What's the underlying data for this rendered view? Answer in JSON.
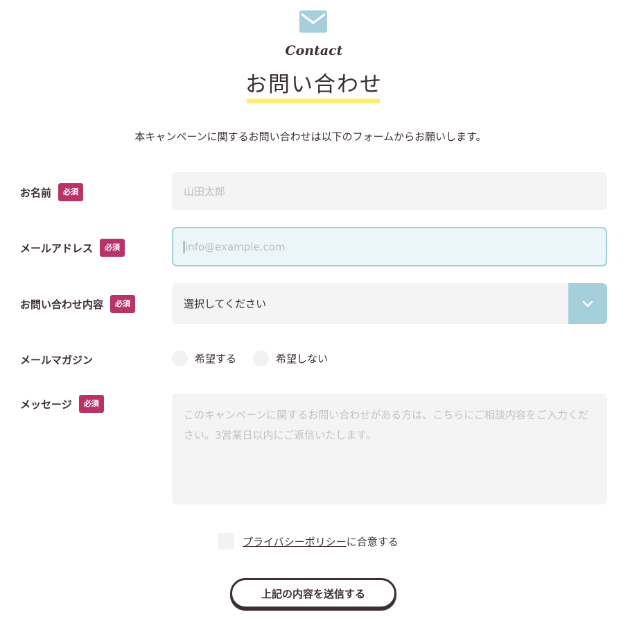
{
  "header": {
    "subtitle": "Contact",
    "title": "お問い合わせ",
    "intro": "本キャンペーンに関するお問い合わせは以下のフォームからお願いします。"
  },
  "colors": {
    "accent": "#a6cfdc",
    "required_badge": "#b93369",
    "underline": "#fcef73",
    "text": "#3e2f2f"
  },
  "form": {
    "required_label": "必須",
    "name": {
      "label": "お名前",
      "placeholder": "山田太郎",
      "value": ""
    },
    "email": {
      "label": "メールアドレス",
      "placeholder": "info@example.com",
      "value": ""
    },
    "inquiry": {
      "label": "お問い合わせ内容",
      "selected": "選択してください"
    },
    "newsletter": {
      "label": "メールマガジン",
      "options": [
        "希望する",
        "希望しない"
      ]
    },
    "message": {
      "label": "メッセージ",
      "placeholder": "このキャンペーンに関するお問い合わせがある方は、こちらにご相談内容をご入力ください。3営業日以内にご返信いたします。"
    },
    "privacy": {
      "link_text": "プライバシーポリシー",
      "suffix": "に合意する"
    },
    "submit_label": "上記の内容を送信する"
  }
}
